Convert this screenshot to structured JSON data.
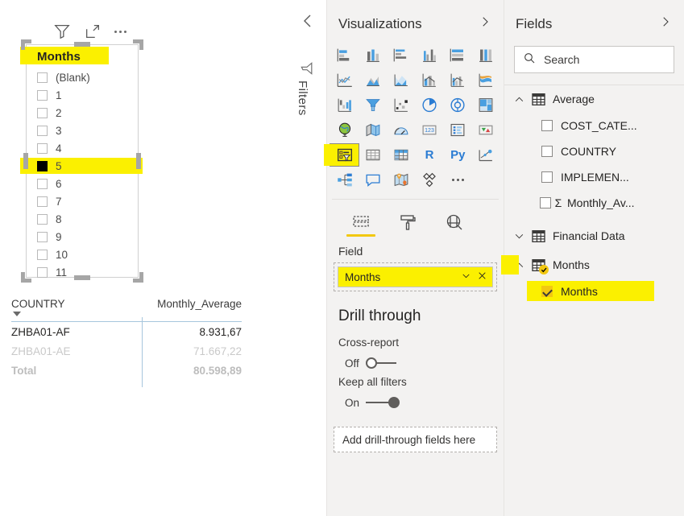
{
  "canvas": {
    "slicer": {
      "title": "Months",
      "toolbar_icons": [
        "filter-icon",
        "focus-mode-icon",
        "more-options-icon"
      ],
      "items": [
        {
          "label": "(Blank)",
          "checked": false,
          "highlighted": false
        },
        {
          "label": "1",
          "checked": false,
          "highlighted": false
        },
        {
          "label": "2",
          "checked": false,
          "highlighted": false
        },
        {
          "label": "3",
          "checked": false,
          "highlighted": false
        },
        {
          "label": "4",
          "checked": false,
          "highlighted": false
        },
        {
          "label": "5",
          "checked": true,
          "highlighted": true
        },
        {
          "label": "6",
          "checked": false,
          "highlighted": false
        },
        {
          "label": "7",
          "checked": false,
          "highlighted": false
        },
        {
          "label": "8",
          "checked": false,
          "highlighted": false
        },
        {
          "label": "9",
          "checked": false,
          "highlighted": false
        },
        {
          "label": "10",
          "checked": false,
          "highlighted": false
        },
        {
          "label": "11",
          "checked": false,
          "highlighted": false
        }
      ]
    },
    "table": {
      "columns": [
        "COUNTRY",
        "Monthly_Average"
      ],
      "rows": [
        {
          "country": "ZHBA01-AF",
          "value": "8.931,67",
          "state": "active"
        },
        {
          "country": "ZHBA01-AE",
          "value": "71.667,22",
          "state": "dim"
        },
        {
          "country": "Total",
          "value": "80.598,89",
          "state": "total"
        }
      ]
    }
  },
  "filters_pane": {
    "title": "Filters",
    "collapse_icon": "chevron-left-icon",
    "funnel_icon": "filter-icon"
  },
  "visualizations": {
    "title": "Visualizations",
    "expand_icon": "chevron-right-icon",
    "gallery": [
      "stacked-bar-chart-icon",
      "stacked-column-chart-icon",
      "clustered-bar-chart-icon",
      "clustered-column-chart-icon",
      "100-stacked-bar-chart-icon",
      "100-stacked-column-chart-icon",
      "line-chart-icon",
      "area-chart-icon",
      "stacked-area-chart-icon",
      "line-stacked-column-chart-icon",
      "line-clustered-column-chart-icon",
      "ribbon-chart-icon",
      "waterfall-chart-icon",
      "funnel-chart-icon",
      "scatter-chart-icon",
      "pie-chart-icon",
      "donut-chart-icon",
      "treemap-icon",
      "map-icon",
      "filled-map-icon",
      "gauge-icon",
      "card-icon",
      "multi-row-card-icon",
      "kpi-icon",
      "slicer-icon",
      "table-icon",
      "matrix-icon",
      "r-script-visual-icon",
      "python-visual-icon",
      "key-influencers-icon",
      "decomposition-tree-icon",
      "q-and-a-icon",
      "arcgis-maps-icon",
      "paginated-report-icon",
      "more-visuals-icon"
    ],
    "selected_visual": "slicer-icon",
    "tabs": [
      {
        "name": "fields-tab",
        "icon": "fields-pane-icon",
        "active": true
      },
      {
        "name": "format-tab",
        "icon": "paint-roller-icon",
        "active": false
      },
      {
        "name": "analytics-tab",
        "icon": "magnifier-chart-icon",
        "active": false
      }
    ],
    "well_label": "Field",
    "field_chip": {
      "label": "Months",
      "chevron_icon": "chevron-down-icon",
      "remove_icon": "close-icon"
    },
    "drill_through": {
      "title": "Drill through",
      "cross_report_label": "Cross-report",
      "cross_report_state": "Off",
      "keep_filters_label": "Keep all filters",
      "keep_filters_state": "On",
      "dropzone_placeholder": "Add drill-through fields here"
    }
  },
  "fields": {
    "title": "Fields",
    "expand_icon": "chevron-right-icon",
    "search": {
      "placeholder": "Search",
      "icon": "search-icon",
      "value": ""
    },
    "tree": [
      {
        "table": "Average",
        "expanded": true,
        "expand_icon": "chevron-up-icon",
        "highlighted": false,
        "badge": false,
        "fields": [
          {
            "label": "COST_CATE...",
            "checked": false,
            "measure": false,
            "highlighted": false
          },
          {
            "label": "COUNTRY",
            "checked": false,
            "measure": false,
            "highlighted": false
          },
          {
            "label": "IMPLEMEN...",
            "checked": false,
            "measure": false,
            "highlighted": false
          },
          {
            "label": "Monthly_Av...",
            "checked": false,
            "measure": true,
            "highlighted": false
          }
        ]
      },
      {
        "table": "Financial Data",
        "expanded": false,
        "expand_icon": "chevron-down-icon",
        "highlighted": false,
        "badge": false,
        "fields": []
      },
      {
        "table": "Months",
        "expanded": true,
        "expand_icon": "chevron-up-icon",
        "highlighted": true,
        "badge": true,
        "fields": [
          {
            "label": "Months",
            "checked": true,
            "measure": false,
            "highlighted": true
          }
        ]
      }
    ]
  },
  "colors": {
    "highlight_yellow": "#fbf000",
    "powerbi_yellow": "#f2c811",
    "pane_background": "#f3f2f1",
    "accent_blue": "#2b7cd3",
    "rule_blue": "#a7c6dd"
  }
}
